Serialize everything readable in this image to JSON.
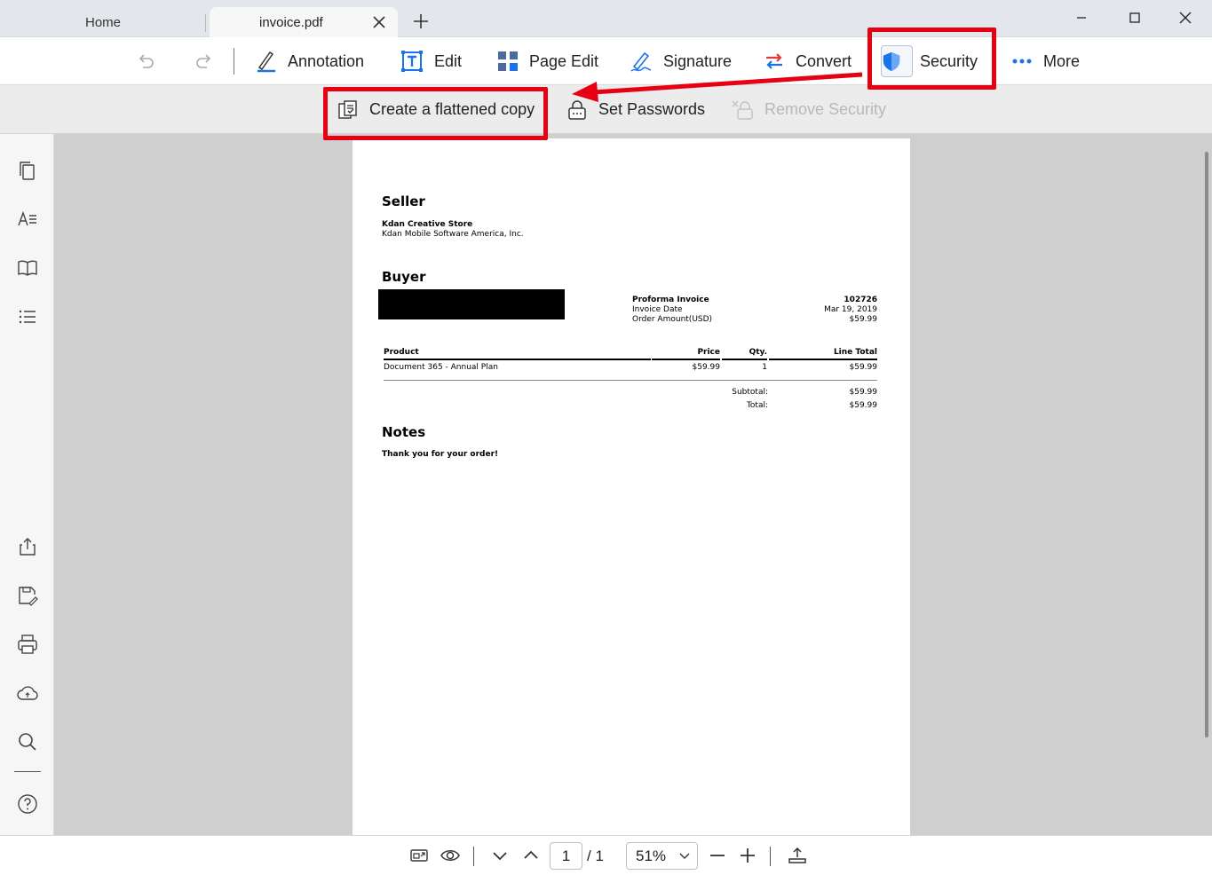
{
  "tabs": {
    "home": "Home",
    "active": "invoice.pdf"
  },
  "toolbar": {
    "annotation": "Annotation",
    "edit": "Edit",
    "page_edit": "Page Edit",
    "signature": "Signature",
    "convert": "Convert",
    "security": "Security",
    "more": "More"
  },
  "security_bar": {
    "flatten": "Create a flattened copy",
    "set_passwords": "Set Passwords",
    "remove_security": "Remove Security"
  },
  "document": {
    "seller_heading": "Seller",
    "seller_name": "Kdan Creative Store",
    "seller_company": "Kdan Mobile Software America, Inc.",
    "buyer_heading": "Buyer",
    "proforma_label": "Proforma Invoice",
    "proforma_value": "102726",
    "invoice_date_label": "Invoice Date",
    "invoice_date_value": "Mar 19, 2019",
    "order_amount_label": "Order Amount(USD)",
    "order_amount_value": "$59.99",
    "table": {
      "headers": {
        "product": "Product",
        "price": "Price",
        "qty": "Qty.",
        "total": "Line Total"
      },
      "rows": [
        {
          "product": "Document 365 - Annual Plan",
          "price": "$59.99",
          "qty": "1",
          "total": "$59.99"
        }
      ]
    },
    "subtotal_label": "Subtotal:",
    "subtotal_value": "$59.99",
    "total_label": "Total:",
    "total_value": "$59.99",
    "notes_heading": "Notes",
    "notes_text": "Thank you for your order!"
  },
  "bottom": {
    "page_current": "1",
    "page_total": "/ 1",
    "zoom": "51%"
  },
  "colors": {
    "highlight": "#e60012",
    "accent_blue": "#1a73e8"
  }
}
